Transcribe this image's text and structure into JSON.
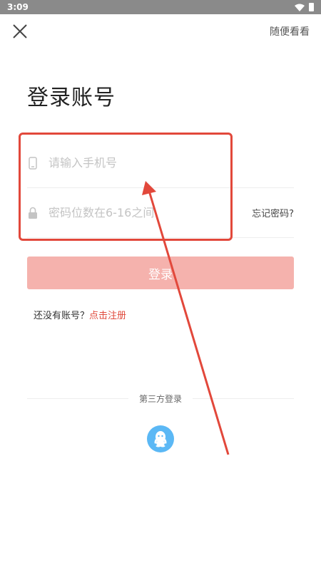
{
  "status_bar": {
    "time": "3:09"
  },
  "header": {
    "browse_label": "随便看看"
  },
  "title": "登录账号",
  "form": {
    "phone_placeholder": "请输入手机号",
    "password_placeholder": "密码位数在6-16之间",
    "forgot_label": "忘记密码?"
  },
  "login_button": "登录",
  "register": {
    "prompt": "还没有账号？",
    "link": "点击注册"
  },
  "third_party": {
    "label": "第三方登录",
    "providers": [
      "qq-icon"
    ]
  },
  "colors": {
    "accent": "#e04a3c",
    "button_bg": "#f5b2ad",
    "qq_blue": "#5bb8f5",
    "annotation_red": "#e2483b"
  }
}
